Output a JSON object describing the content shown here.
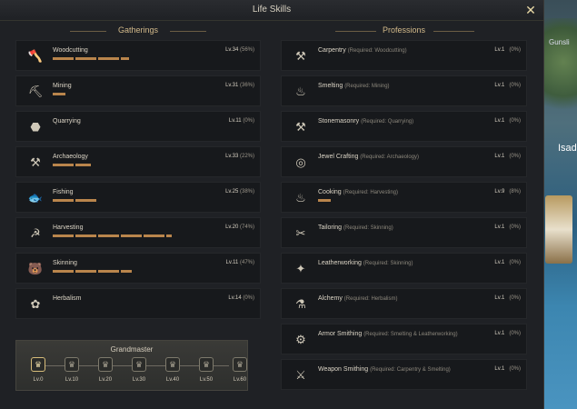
{
  "window": {
    "title": "Life Skills"
  },
  "left_header": "Gatherings",
  "right_header": "Professions",
  "gatherings": [
    {
      "name": "Woodcutting",
      "level": "Lv.34",
      "pct": "(56%)",
      "progress": 0.56,
      "icon": "axe-log-icon"
    },
    {
      "name": "Mining",
      "level": "Lv.31",
      "pct": "(36%)",
      "progress": 0.09,
      "icon": "pickaxe-icon"
    },
    {
      "name": "Quarrying",
      "level": "Lv.11",
      "pct": "(0%)",
      "progress": 0,
      "icon": "stone-icon"
    },
    {
      "name": "Archaeology",
      "level": "Lv.33",
      "pct": "(22%)",
      "progress": 0.28,
      "icon": "shovel-icon"
    },
    {
      "name": "Fishing",
      "level": "Lv.25",
      "pct": "(38%)",
      "progress": 0.33,
      "icon": "fish-icon"
    },
    {
      "name": "Harvesting",
      "level": "Lv.20",
      "pct": "(74%)",
      "progress": 0.87,
      "icon": "sickle-icon"
    },
    {
      "name": "Skinning",
      "level": "Lv.11",
      "pct": "(47%)",
      "progress": 0.58,
      "icon": "hide-icon"
    },
    {
      "name": "Herbalism",
      "level": "Lv.14",
      "pct": "(0%)",
      "progress": 0,
      "icon": "herb-icon"
    }
  ],
  "professions": [
    {
      "name": "Carpentry",
      "req": "(Required: Woodcutting)",
      "level": "Lv.1",
      "pct": "(0%)",
      "icon": "saw-icon"
    },
    {
      "name": "Smelting",
      "req": "(Required: Mining)",
      "level": "Lv.1",
      "pct": "(0%)",
      "icon": "crucible-icon"
    },
    {
      "name": "Stonemasonry",
      "req": "(Required: Quarrying)",
      "level": "Lv.1",
      "pct": "(0%)",
      "icon": "chisel-icon"
    },
    {
      "name": "Jewel Crafting",
      "req": "(Required: Archaeology)",
      "level": "Lv.1",
      "pct": "(0%)",
      "icon": "ring-icon"
    },
    {
      "name": "Cooking",
      "req": "(Required: Harvesting)",
      "level": "Lv.9",
      "pct": "(8%)",
      "progress": 0.08,
      "icon": "pot-icon"
    },
    {
      "name": "Tailoring",
      "req": "(Required: Skinning)",
      "level": "Lv.1",
      "pct": "(0%)",
      "icon": "needle-icon"
    },
    {
      "name": "Leatherworking",
      "req": "(Required: Skinning)",
      "level": "Lv.1",
      "pct": "(0%)",
      "icon": "leather-icon"
    },
    {
      "name": "Alchemy",
      "req": "(Required: Herbalism)",
      "level": "Lv.1",
      "pct": "(0%)",
      "icon": "flask-icon"
    },
    {
      "name": "Armor Smithing",
      "req": "(Required: Smelting & Leatherworking)",
      "level": "Lv.1",
      "pct": "(0%)",
      "icon": "anvil-icon"
    },
    {
      "name": "Weapon Smithing",
      "req": "(Required: Carpentry & Smelting)",
      "level": "Lv.1",
      "pct": "(0%)",
      "icon": "hammer-icon"
    }
  ],
  "grandmaster": {
    "title": "Grandmaster",
    "levels": [
      "Lv.0",
      "Lv.10",
      "Lv.20",
      "Lv.30",
      "Lv.40",
      "Lv.50",
      "Lv.60"
    ],
    "active_index": 0
  },
  "world": {
    "nameplate": "Isad",
    "tag": "Gunsli"
  }
}
